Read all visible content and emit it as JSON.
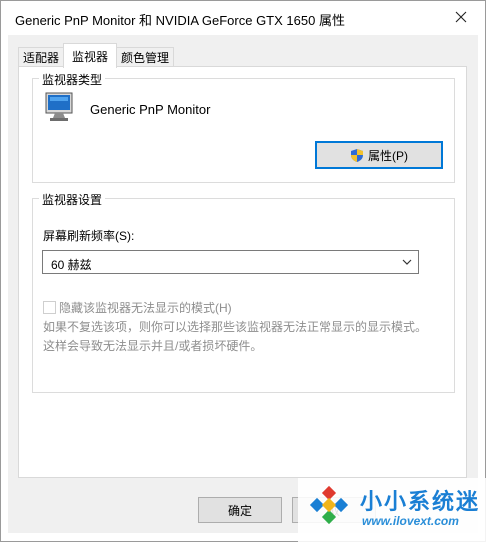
{
  "window": {
    "title": "Generic PnP Monitor 和 NVIDIA GeForce GTX 1650 属性",
    "close_glyph": "✕"
  },
  "tabs": [
    {
      "label": "适配器",
      "active": false
    },
    {
      "label": "监视器",
      "active": true
    },
    {
      "label": "颜色管理",
      "active": false
    }
  ],
  "monitor_type": {
    "group_label": "监视器类型",
    "name": "Generic PnP Monitor",
    "properties_button": "属性(P)"
  },
  "monitor_settings": {
    "group_label": "监视器设置",
    "refresh_label": "屏幕刷新频率(S):",
    "refresh_value": "60 赫兹",
    "hide_modes_label": "隐藏该监视器无法显示的模式(H)",
    "hide_modes_checked": false,
    "description_line1": "如果不复选该项，则你可以选择那些该监视器无法正常显示的显示模式。",
    "description_line2": "这样会导致无法显示并且/或者损坏硬件。"
  },
  "footer": {
    "ok": "确定",
    "cancel_partial": "取"
  },
  "watermark": {
    "title": "小小系统迷",
    "url": "www.ilovext.com"
  },
  "colors": {
    "accent": "#0078d7",
    "watermark_blue": "#1a7fd4"
  },
  "icons": {
    "monitor": "monitor-icon",
    "shield": "uac-shield-icon",
    "dropdown": "chevron-down-icon",
    "close": "close-icon"
  }
}
